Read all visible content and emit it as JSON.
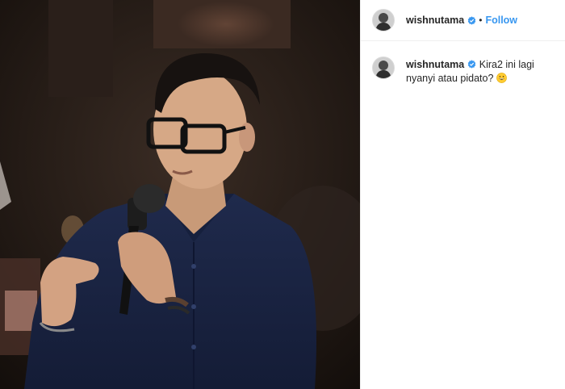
{
  "post": {
    "header": {
      "username": "wishnutama",
      "separator": "•",
      "follow_label": "Follow"
    },
    "caption": {
      "username": "wishnutama",
      "text": "Kira2 ini lagi nyanyi atau pidato?",
      "emoji": "grinning-face-emoji"
    },
    "colors": {
      "accent": "#3897f0",
      "text": "#262626",
      "border": "#efefef"
    }
  }
}
